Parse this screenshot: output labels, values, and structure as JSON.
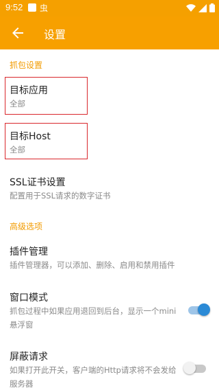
{
  "status_bar": {
    "time": "9:52",
    "app_icon_2_glyph": "虫"
  },
  "app_bar": {
    "title": "设置"
  },
  "sections": {
    "capture": {
      "header": "抓包设置"
    },
    "advanced": {
      "header": "高级选项"
    }
  },
  "items": {
    "target_app": {
      "title": "目标应用",
      "subtitle": "全部"
    },
    "target_host": {
      "title": "目标Host",
      "subtitle": "全部"
    },
    "ssl_cert": {
      "title": "SSL证书设置",
      "subtitle": "配置用于SSL请求的数字证书"
    },
    "plugins": {
      "title": "插件管理",
      "subtitle": "插件管理器，可以添加、删除、启用和禁用插件"
    },
    "window_mode": {
      "title": "窗口模式",
      "subtitle": "抓包过程中如果应用退回到后台，显示一个mini悬浮窗",
      "enabled": true
    },
    "block_requests": {
      "title": "屏蔽请求",
      "subtitle": "如果打开此开关，客户端的Http请求将不会发给服务器",
      "enabled": false
    }
  },
  "colors": {
    "accent": "#f7a000",
    "section_header": "#f29b00",
    "highlight_box": "#d9262b",
    "switch_on": "#2b8ad6"
  },
  "icons": {
    "back": "arrow-left-icon",
    "wifi": "wifi-icon",
    "signal": "cell-signal-icon",
    "battery": "battery-icon"
  }
}
